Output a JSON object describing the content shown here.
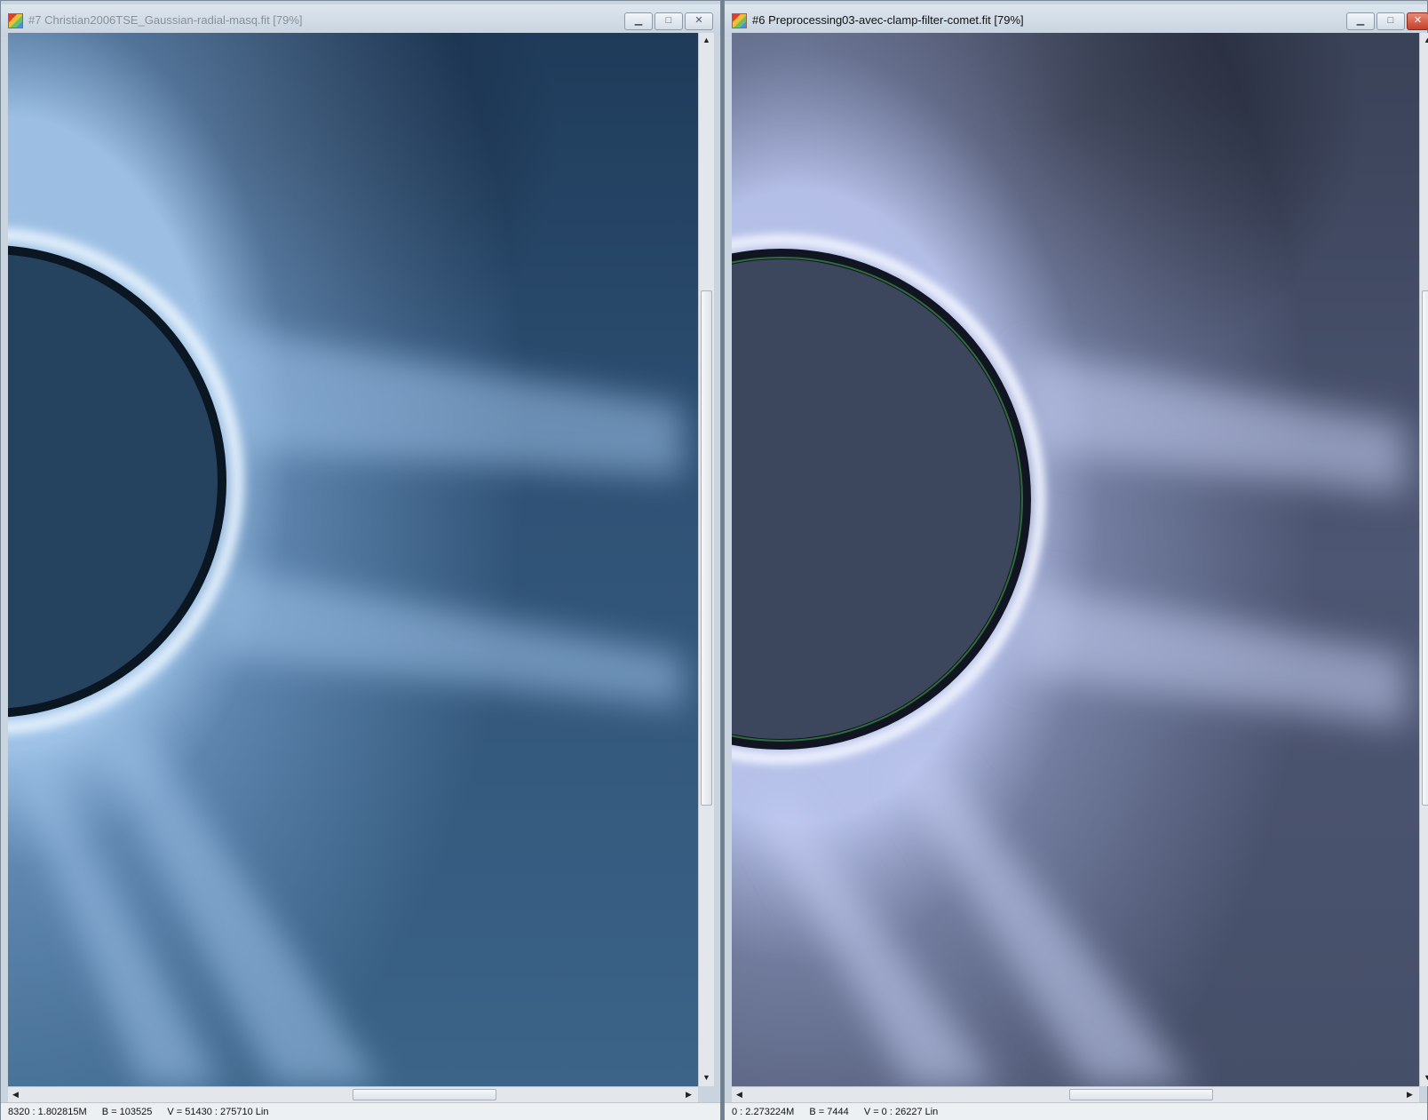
{
  "windows": [
    {
      "title": "#7 Christian2006TSE_Gaussian-radial-masq.fit  [79%]",
      "controls": {
        "minimize": "▁",
        "maximize": "□",
        "close": "✕"
      },
      "status": {
        "coords": "8320 : 1.802815M",
        "b": "B = 103525",
        "v": "V = 51430 : 275710 Lin"
      },
      "colors": {
        "sky": "#2f5275",
        "sky_dark": "#14253a",
        "disk": "#25425f",
        "corona": "#a9cdf2"
      }
    },
    {
      "title": "#6 Preprocessing03-avec-clamp-filter-comet.fit  [79%]",
      "controls": {
        "minimize": "▁",
        "maximize": "□",
        "close": "✕"
      },
      "status": {
        "coords": "0 : 2.273224M",
        "b": "B = 7444",
        "v": "V = 0 : 26227 Lin"
      },
      "colors": {
        "sky": "#4d5672",
        "sky_dark": "#161a24",
        "disk": "#3c465d",
        "corona": "#c9d4ff"
      }
    }
  ]
}
